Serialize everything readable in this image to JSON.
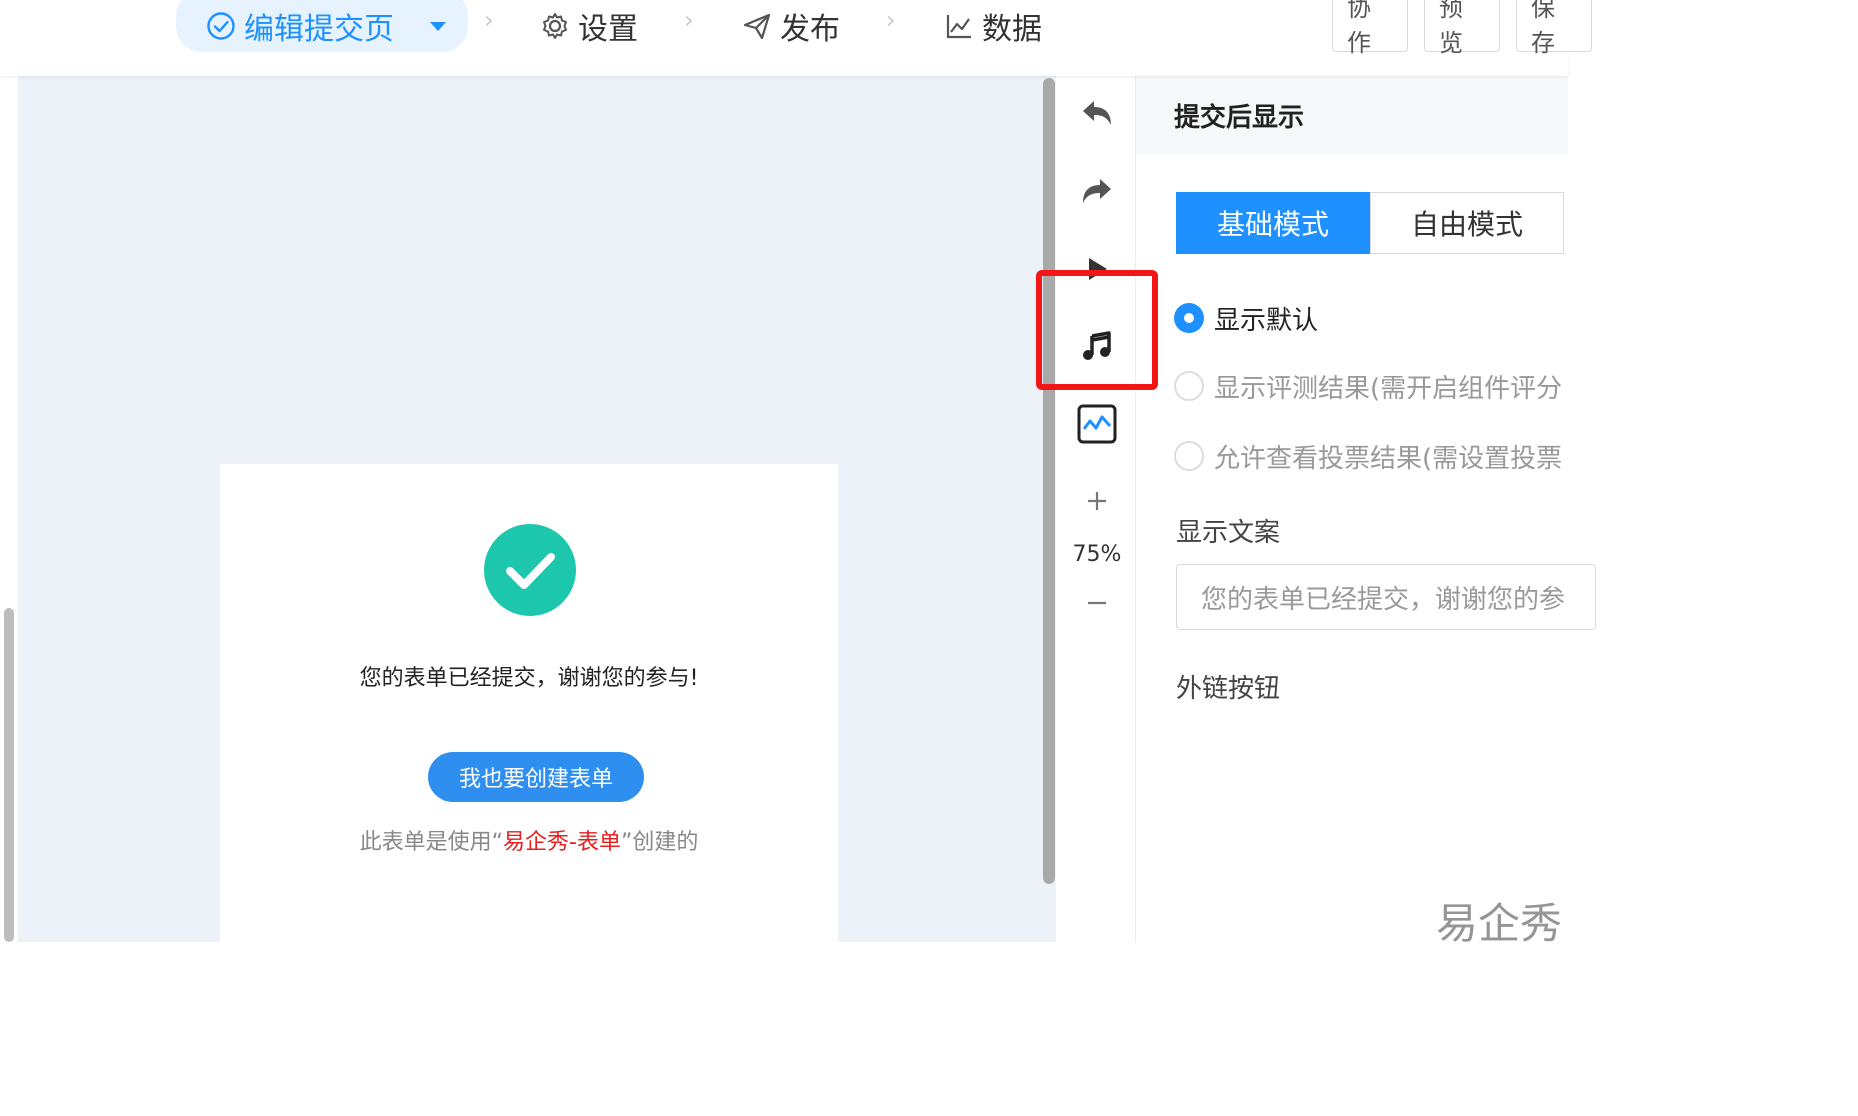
{
  "steps": [
    {
      "label": "编辑提交页",
      "icon": "check-circle-icon",
      "active": true
    },
    {
      "label": "设置",
      "icon": "gear-icon"
    },
    {
      "label": "发布",
      "icon": "send-icon"
    },
    {
      "label": "数据",
      "icon": "chart-icon"
    }
  ],
  "actions": {
    "collaborate": "协作",
    "preview": "预览",
    "save": "保存"
  },
  "canvas": {
    "submitted_message": "您的表单已经提交，谢谢您的参与!",
    "create_button": "我也要创建表单",
    "footer_prefix": "此表单是使用“",
    "footer_brand": "易企秀-表单",
    "footer_suffix": "”创建的"
  },
  "toolbar": {
    "zoom": "75%",
    "icons": [
      "undo-icon",
      "redo-icon",
      "play-icon",
      "music-icon",
      "analytics-icon",
      "zoom-in-icon",
      "zoom-out-icon"
    ]
  },
  "panel": {
    "title": "提交后显示",
    "mode_basic": "基础模式",
    "mode_free": "自由模式",
    "option_default": "显示默认",
    "option_result": "显示评测结果(需开启组件评分",
    "option_vote": "允许查看投票结果(需设置投票",
    "copy_label": "显示文案",
    "copy_value": "您的表单已经提交，谢谢您的参",
    "link_label": "外链按钮"
  },
  "watermark": "易企秀",
  "colors": {
    "accent": "#1e90ff",
    "success": "#1cc7ae",
    "highlight": "#f21616",
    "brand_red": "#e61e1e"
  }
}
